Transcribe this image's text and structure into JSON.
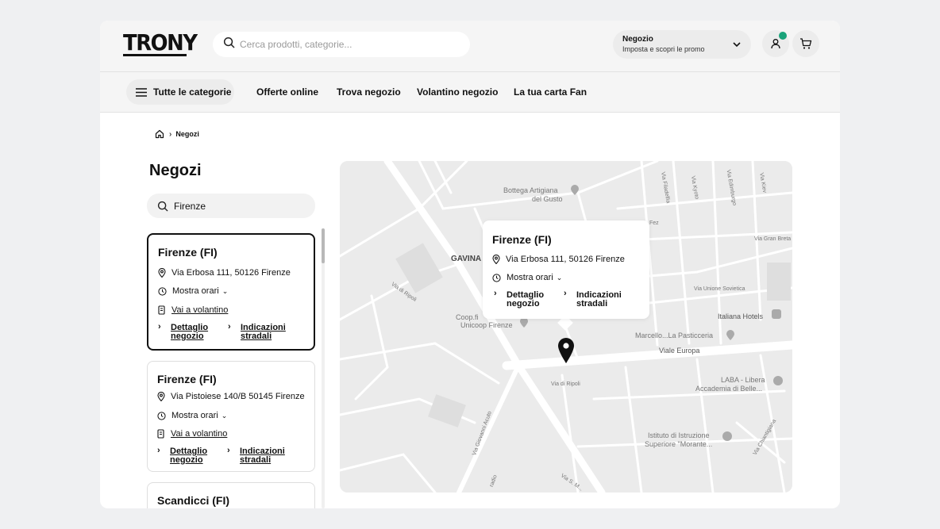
{
  "header": {
    "logo": "TRONY",
    "search_placeholder": "Cerca prodotti, categorie...",
    "store_select": {
      "title": "Negozio",
      "subtitle": "Imposta e scopri le promo"
    }
  },
  "nav": {
    "all_categories": "Tutte le categorie",
    "links": [
      "Offerte online",
      "Trova negozio",
      "Volantino negozio",
      "La tua carta Fan"
    ]
  },
  "breadcrumb": {
    "current": "Negozi"
  },
  "page": {
    "title": "Negozi",
    "search_value": "Firenze"
  },
  "stores": [
    {
      "name": "Firenze (FI)",
      "address": "Via Erbosa 111, 50126 Firenze",
      "hours": "Mostra orari",
      "flyer": "Vai a volantino",
      "detail_1": "Dettaglio",
      "detail_2": "negozio",
      "dir_1": "Indicazioni",
      "dir_2": "stradali"
    },
    {
      "name": "Firenze (FI)",
      "address": "Via Pistoiese 140/B 50145 Firenze",
      "hours": "Mostra orari",
      "flyer": "Vai a volantino",
      "detail_1": "Dettaglio",
      "detail_2": "negozio",
      "dir_1": "Indicazioni",
      "dir_2": "stradali"
    },
    {
      "name": "Scandicci (FI)"
    }
  ],
  "map": {
    "popup": {
      "name": "Firenze (FI)",
      "address": "Via Erbosa 111, 50126 Firenze",
      "hours": "Mostra orari",
      "detail_1": "Dettaglio",
      "detail_2": "negozio",
      "dir_1": "Indicazioni",
      "dir_2": "stradali"
    },
    "labels": {
      "bottega_1": "Bottega Artigiana",
      "bottega_2": "del Gusto",
      "gavina": "GAVINA",
      "coop_1": "Coop.fi",
      "coop_2": "Unicoop Firenze",
      "via_ripoli_1": "Via di Ripoli",
      "via_ripoli_2": "Via di Ripoli",
      "viale_europa": "Viale Europa",
      "marcello": "Marcello...La Pasticceria",
      "italiana_hotels": "Italiana Hotels",
      "laba_1": "LABA - Libera",
      "laba_2": "Accademia di Belle...",
      "istituto_1": "Istituto di Istruzione",
      "istituto_2": "Superiore \"Morante...",
      "via_unione": "Via Unione Sovietica",
      "via_gran": "Via Gran Breta",
      "fez": "Fez",
      "via_filadelfia": "Via Filadelfia",
      "via_kyoto": "Via Kyoto",
      "via_edimburgo": "Via Edimburgo",
      "via_kiev": "Via Kiev",
      "via_acuto": "Via Giovanni Acuto",
      "via_chiantigiana": "Via Chiantigiana",
      "via_s": "Via S. M...",
      "radio": "radio"
    }
  }
}
